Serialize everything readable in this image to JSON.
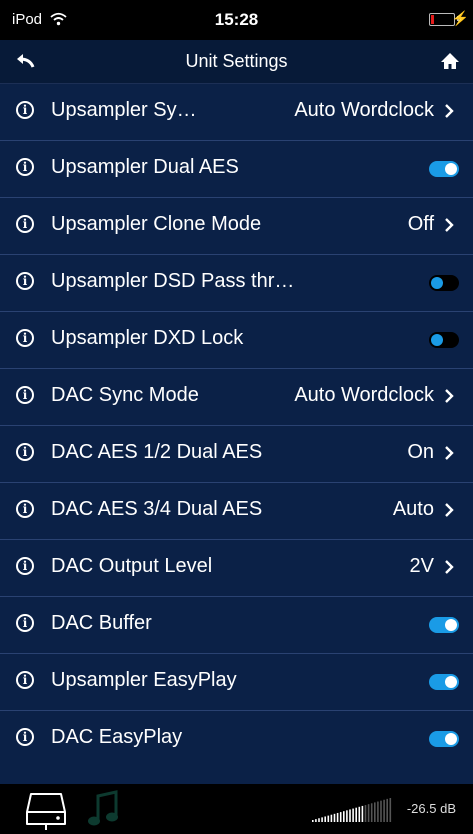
{
  "status": {
    "carrier": "iPod",
    "time": "15:28"
  },
  "nav": {
    "title": "Unit Settings"
  },
  "rows": [
    {
      "label": "Upsampler Sy…",
      "value": "Auto Wordclock",
      "control": "chevron"
    },
    {
      "label": "Upsampler Dual AES",
      "value": "",
      "control": "toggle",
      "state": "on"
    },
    {
      "label": "Upsampler Clone Mode",
      "value": "Off",
      "control": "chevron"
    },
    {
      "label": "Upsampler DSD Pass thr…",
      "value": "",
      "control": "toggle",
      "state": "off"
    },
    {
      "label": "Upsampler DXD Lock",
      "value": "",
      "control": "toggle",
      "state": "off"
    },
    {
      "label": "DAC Sync Mode",
      "value": "Auto Wordclock",
      "control": "chevron"
    },
    {
      "label": "DAC AES 1/2 Dual AES",
      "value": "On",
      "control": "chevron"
    },
    {
      "label": "DAC AES 3/4 Dual AES",
      "value": "Auto",
      "control": "chevron"
    },
    {
      "label": "DAC Output Level",
      "value": "2V",
      "control": "chevron"
    },
    {
      "label": "DAC Buffer",
      "value": "",
      "control": "toggle",
      "state": "on"
    },
    {
      "label": "Upsampler EasyPlay",
      "value": "",
      "control": "toggle",
      "state": "on"
    },
    {
      "label": "DAC EasyPlay",
      "value": "",
      "control": "toggle",
      "state": "on"
    }
  ],
  "footer": {
    "volume": "-26.5 dB"
  },
  "icons": {
    "info": "info-icon",
    "chevron": "chevron-right-icon",
    "back": "back-arrow-icon",
    "home": "home-icon",
    "wifi": "wifi-icon",
    "battery": "battery-icon",
    "charging": "charging-bolt-icon",
    "drive": "drive-icon",
    "music": "music-note-icon",
    "volume": "volume-bars-icon"
  },
  "colors": {
    "background": "#0b2147",
    "nav": "#071a38",
    "accent": "#1a9be6",
    "battery_low": "#e31b1b"
  }
}
